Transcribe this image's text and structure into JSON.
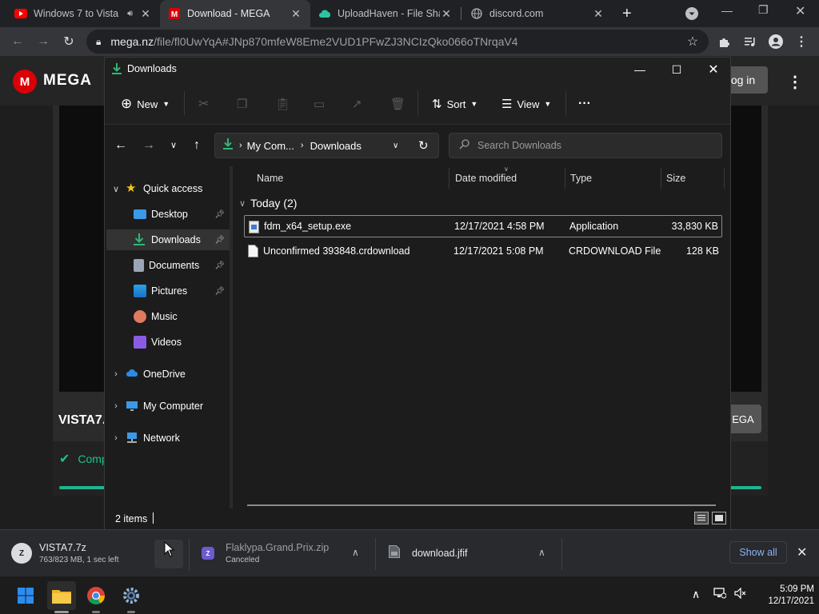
{
  "browser": {
    "tabs": [
      {
        "title": "Windows 7 to Vista",
        "favicon": "youtube-icon",
        "active": false
      },
      {
        "title": "Download - MEGA",
        "favicon": "mega-icon",
        "active": true
      },
      {
        "title": "UploadHaven - File Sha",
        "favicon": "uploadhaven-icon",
        "active": false
      },
      {
        "title": "discord.com",
        "favicon": "globe-icon",
        "active": false
      }
    ],
    "url_host": "mega.nz",
    "url_path": "/file/fl0UwYqA#JNp870mfeW8Eme2VUD1PFwZJ3NCIzQko066oTNrqaV4"
  },
  "mega": {
    "logo_letter": "M",
    "logo_text": "MEGA",
    "login_label": "og in",
    "file_name": "VISTA7.",
    "download_label": "EGA",
    "complete_label": "Comp",
    "brand_color": "#d90007",
    "success_color": "#17c48c"
  },
  "explorer": {
    "title": "Downloads",
    "commands": {
      "new": "New",
      "sort": "Sort",
      "view": "View",
      "more": "···"
    },
    "breadcrumb": [
      "My Com...",
      "Downloads"
    ],
    "search_placeholder": "Search Downloads",
    "nav": {
      "quick_access": "Quick access",
      "desktop": "Desktop",
      "downloads": "Downloads",
      "documents": "Documents",
      "pictures": "Pictures",
      "music": "Music",
      "videos": "Videos",
      "onedrive": "OneDrive",
      "my_computer": "My Computer",
      "network": "Network"
    },
    "columns": {
      "name": "Name",
      "date": "Date modified",
      "type": "Type",
      "size": "Size"
    },
    "group_label": "Today (2)",
    "files": [
      {
        "name": "fdm_x64_setup.exe",
        "date": "12/17/2021 4:58 PM",
        "type": "Application",
        "size": "33,830 KB"
      },
      {
        "name": "Unconfirmed 393848.crdownload",
        "date": "12/17/2021 5:08 PM",
        "type": "CRDOWNLOAD File",
        "size": "128 KB"
      }
    ],
    "status": "2 items"
  },
  "downloads_shelf": {
    "items": [
      {
        "name": "VISTA7.7z",
        "detail": "763/823 MB, 1 sec left",
        "icon": "archive-icon"
      },
      {
        "name": "Flaklypa.Grand.Prix.zip",
        "detail": "Canceled",
        "icon": "archive-icon"
      },
      {
        "name": "download.jfif",
        "detail": "",
        "icon": "image-file-icon"
      }
    ],
    "show_all": "Show all"
  },
  "taskbar": {
    "time": "5:09 PM",
    "date": "12/17/2021"
  }
}
